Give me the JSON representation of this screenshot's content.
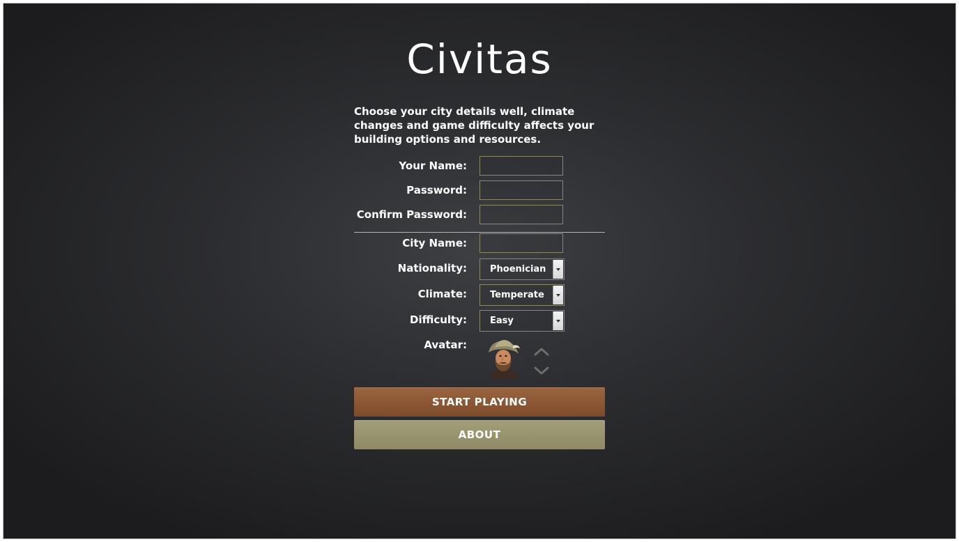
{
  "app": {
    "title": "Civitas",
    "intro": "Choose your city details well, climate changes and game difficulty affects your building options and resources."
  },
  "form": {
    "your_name": {
      "label": "Your Name:",
      "value": ""
    },
    "password": {
      "label": "Password:",
      "value": ""
    },
    "confirm_password": {
      "label": "Confirm Password:",
      "value": ""
    },
    "city_name": {
      "label": "City Name:",
      "value": ""
    },
    "nationality": {
      "label": "Nationality:",
      "value": "Phoenician"
    },
    "climate": {
      "label": "Climate:",
      "value": "Temperate"
    },
    "difficulty": {
      "label": "Difficulty:",
      "value": "Easy"
    },
    "avatar": {
      "label": "Avatar:",
      "icon": "bearded-man-portrait"
    }
  },
  "buttons": {
    "start": "START PLAYING",
    "about": "ABOUT"
  },
  "colors": {
    "start_button": "#8a5735",
    "about_button": "#98946e",
    "field_border": "#8a8a6a"
  }
}
